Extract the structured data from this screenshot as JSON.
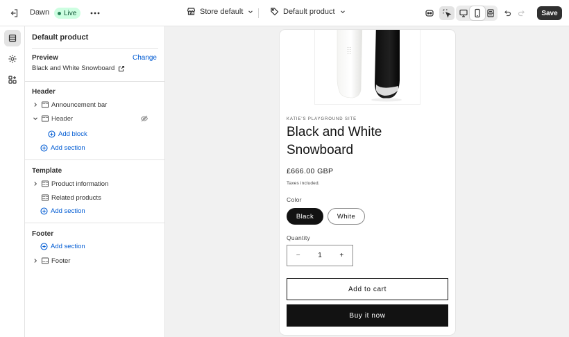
{
  "topbar": {
    "theme_name": "Dawn",
    "live_badge": "Live",
    "store_selector": "Store default",
    "template_selector": "Default product",
    "save_label": "Save",
    "icons": {
      "exit": "exit-icon",
      "more": "more-horizontal-icon",
      "store": "store-icon",
      "template": "tag-icon",
      "ai": "sidekick-icon",
      "inspector": "inspector-icon",
      "desktop": "desktop-icon",
      "mobile": "mobile-icon",
      "fullwidth": "fullwidth-icon",
      "undo": "undo-icon",
      "redo": "redo-icon"
    }
  },
  "rail": {
    "items": [
      {
        "name": "sections",
        "icon": "sections-icon",
        "active": true
      },
      {
        "name": "theme-settings",
        "icon": "gear-icon",
        "active": false
      },
      {
        "name": "app-embeds",
        "icon": "apps-icon",
        "active": false
      }
    ]
  },
  "sidebar": {
    "title": "Default product",
    "preview": {
      "label": "Preview",
      "change": "Change",
      "value": "Black and White Snowboard"
    },
    "header_group": {
      "label": "Header",
      "items": [
        {
          "label": "Announcement bar",
          "expandable": true,
          "expanded": false
        },
        {
          "label": "Header",
          "expandable": true,
          "expanded": true,
          "hidden_toggle": true
        }
      ],
      "add_block": "Add block",
      "add_section": "Add section"
    },
    "template_group": {
      "label": "Template",
      "items": [
        {
          "label": "Product information",
          "expandable": true
        },
        {
          "label": "Related products",
          "expandable": false
        }
      ],
      "add_section": "Add section"
    },
    "footer_group": {
      "label": "Footer",
      "add_section": "Add section",
      "items": [
        {
          "label": "Footer",
          "expandable": true
        }
      ]
    }
  },
  "preview": {
    "vendor": "KATIE'S PLAYGROUND SITE",
    "title": "Black and White Snowboard",
    "price": "£666.00 GBP",
    "tax_note": "Taxes included.",
    "color_label": "Color",
    "color_options": [
      "Black",
      "White"
    ],
    "selected_color": "Black",
    "quantity_label": "Quantity",
    "quantity_value": "1",
    "quantity_minus": "−",
    "quantity_plus": "+",
    "add_to_cart": "Add to cart",
    "buy_now": "Buy it now"
  },
  "colors": {
    "accent_link": "#005bd3",
    "live_bg": "#cdfee1",
    "save_bg": "#303030",
    "buy_bg": "#121212"
  }
}
